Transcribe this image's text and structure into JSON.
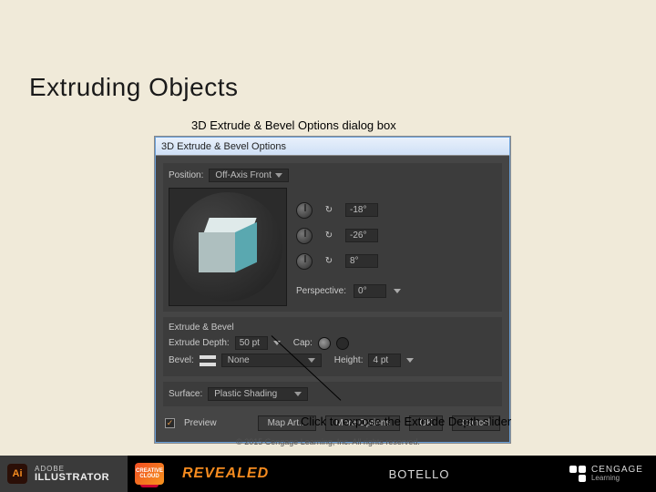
{
  "slide": {
    "title": "Extruding Objects",
    "caption_top": "3D Extrude & Bevel Options dialog box",
    "caption_bottom": "Click to expose the Extrude Depth slider"
  },
  "dialog": {
    "title": "3D Extrude & Bevel Options",
    "position": {
      "label": "Position:",
      "value": "Off-Axis Front"
    },
    "rotation": {
      "x": {
        "icon": "↻",
        "value": "-18°"
      },
      "y": {
        "icon": "↻",
        "value": "-26°"
      },
      "z": {
        "icon": "↻",
        "value": "8°"
      }
    },
    "perspective": {
      "label": "Perspective:",
      "value": "0°"
    },
    "extrude_bevel": {
      "section": "Extrude & Bevel",
      "depth_label": "Extrude Depth:",
      "depth_value": "50 pt",
      "cap_label": "Cap:",
      "bevel_label": "Bevel:",
      "bevel_value": "None",
      "height_label": "Height:",
      "height_value": "4 pt"
    },
    "surface": {
      "label": "Surface:",
      "value": "Plastic Shading"
    },
    "buttons": {
      "preview": "Preview",
      "map_art": "Map Art...",
      "more": "More Options",
      "ok": "OK",
      "cancel": "Cancel"
    }
  },
  "copyright": "© 2015 Cengage Learning, Inc. All rights reserved.",
  "footer": {
    "adobe_small": "ADOBE",
    "adobe_big": "ILLUSTRATOR",
    "cc1": "CREATIVE",
    "cc2": "CLOUD",
    "revealed": "REVEALED",
    "author": "BOTELLO",
    "cengage": "CENGAGE",
    "learning": "Learning"
  }
}
